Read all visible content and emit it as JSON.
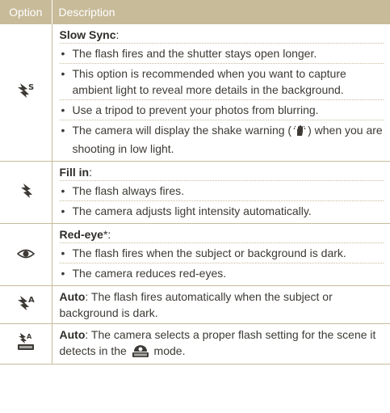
{
  "header": {
    "option": "Option",
    "description": "Description"
  },
  "rows": [
    {
      "icon": "flash-slow-sync-icon",
      "title": "Slow Sync",
      "title_suffix": ":",
      "bullets": [
        "The flash fires and the shutter stays open longer.",
        "This option is recommended when you want to capture ambient light to reveal more details in the background.",
        "Use a tripod to prevent your photos from blurring."
      ],
      "shake_bullet": {
        "before": "The camera will display the shake warning (",
        "after": ") when you are shooting in low light."
      }
    },
    {
      "icon": "flash-fill-in-icon",
      "title": "Fill in",
      "title_suffix": ":",
      "bullets": [
        "The flash always fires.",
        "The camera adjusts light intensity automatically."
      ]
    },
    {
      "icon": "red-eye-icon",
      "title": "Red-eye",
      "title_suffix": "*:",
      "bullets": [
        "The flash fires when the subject or background is dark.",
        "The camera reduces red-eyes."
      ]
    },
    {
      "icon": "flash-auto-icon",
      "label": "Auto",
      "text": ": The flash fires automatically when the subject or background is dark."
    },
    {
      "icon": "flash-smart-auto-icon",
      "label": "Auto",
      "text_before": ": The camera selects a proper flash setting for the scene it detects in the ",
      "text_after": " mode."
    }
  ]
}
